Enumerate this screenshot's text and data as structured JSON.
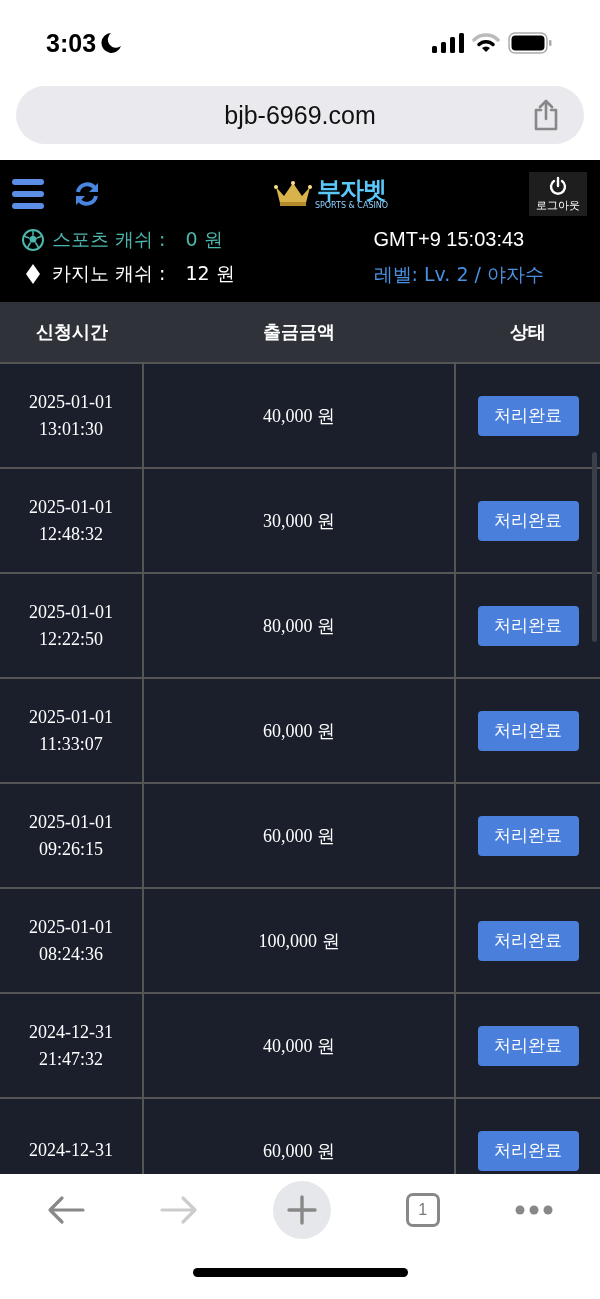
{
  "status_bar": {
    "time": "3:03"
  },
  "address_bar": {
    "url": "bjb-6969.com"
  },
  "header": {
    "logo": {
      "name": "부자벳",
      "tagline": "SPORTS & CASINO"
    },
    "logout_label": "로그아웃"
  },
  "balances": [
    {
      "kind": "sports",
      "label": "스포츠 캐쉬 :",
      "amount": "0 원"
    },
    {
      "kind": "casino",
      "label": "카지노 캐쉬 :",
      "amount": "12 원"
    }
  ],
  "clock": "GMT+9 15:03:43",
  "level": "레벨: Lv. 2 / 야자수",
  "table": {
    "columns": [
      "신청시간",
      "출금금액",
      "상태"
    ],
    "rows": [
      {
        "date": "2025-01-01",
        "time": "13:01:30",
        "amount": "40,000 원",
        "status": "처리완료"
      },
      {
        "date": "2025-01-01",
        "time": "12:48:32",
        "amount": "30,000 원",
        "status": "처리완료"
      },
      {
        "date": "2025-01-01",
        "time": "12:22:50",
        "amount": "80,000 원",
        "status": "처리완료"
      },
      {
        "date": "2025-01-01",
        "time": "11:33:07",
        "amount": "60,000 원",
        "status": "처리완료"
      },
      {
        "date": "2025-01-01",
        "time": "09:26:15",
        "amount": "60,000 원",
        "status": "처리완료"
      },
      {
        "date": "2025-01-01",
        "time": "08:24:36",
        "amount": "100,000 원",
        "status": "처리완료"
      },
      {
        "date": "2024-12-31",
        "time": "21:47:32",
        "amount": "40,000 원",
        "status": "처리완료"
      },
      {
        "date": "2024-12-31",
        "amount": "60,000 원",
        "status": "처리완료"
      }
    ]
  },
  "toolbar": {
    "tab_count": "1"
  }
}
